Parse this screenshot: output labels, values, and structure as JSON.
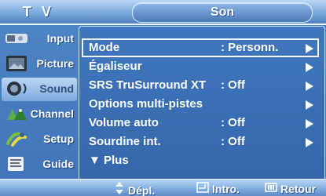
{
  "header": {
    "left_label": "T V",
    "title": "Son"
  },
  "sidebar": {
    "items": [
      {
        "label": "Input",
        "icon": "input-icon"
      },
      {
        "label": "Picture",
        "icon": "picture-icon"
      },
      {
        "label": "Sound",
        "icon": "sound-icon"
      },
      {
        "label": "Channel",
        "icon": "channel-icon"
      },
      {
        "label": "Setup",
        "icon": "setup-icon"
      },
      {
        "label": "Guide",
        "icon": "guide-icon"
      }
    ]
  },
  "menu": {
    "rows": [
      {
        "label": "Mode",
        "value": ": Personn."
      },
      {
        "label": "Égaliseur",
        "value": ""
      },
      {
        "label": "SRS TruSurround XT",
        "value": ": Off"
      },
      {
        "label": "Options multi-pistes",
        "value": ""
      },
      {
        "label": "Volume auto",
        "value": ": Off"
      },
      {
        "label": "Sourdine int.",
        "value": ": Off"
      }
    ],
    "more_label": "▼ Plus"
  },
  "footer": {
    "move_label": "Dépl.",
    "enter_label": "Intro.",
    "return_label": "Retour"
  }
}
